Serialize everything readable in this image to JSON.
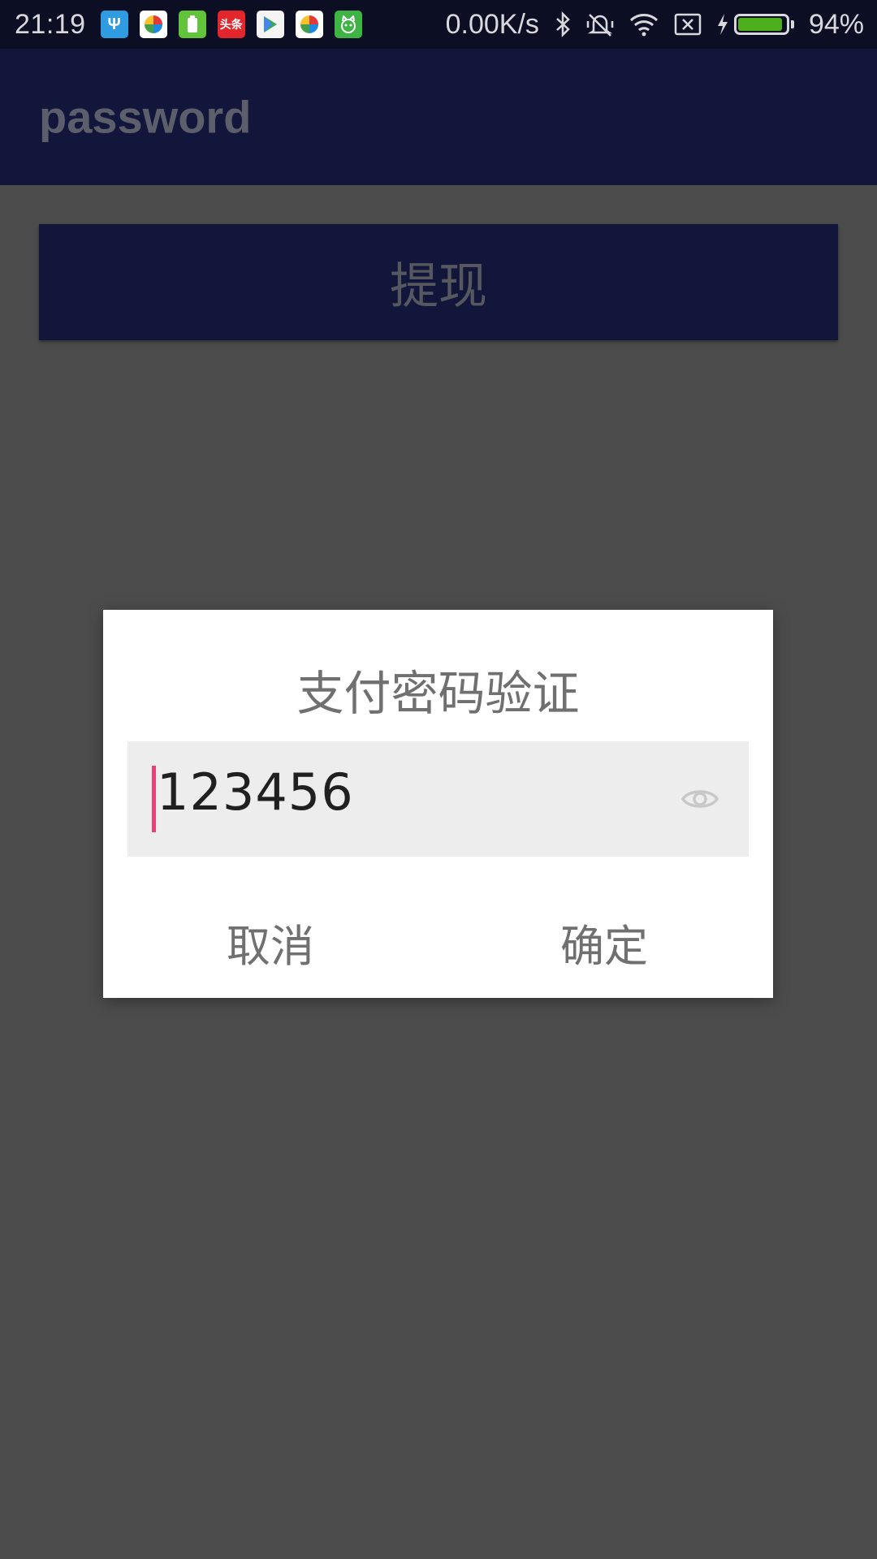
{
  "status_bar": {
    "time": "21:19",
    "network_speed": "0.00K/s",
    "battery_percent": "94%",
    "battery_level": 0.94,
    "app_icons": [
      {
        "name": "usb-icon",
        "color": "#2f9be0",
        "glyph": "Ψ"
      },
      {
        "name": "pinwheel-app-icon",
        "color": "#ffffff",
        "glyph": "◉"
      },
      {
        "name": "battery-app-icon",
        "color": "#62c43a",
        "glyph": "▮"
      },
      {
        "name": "toutiao-app-icon",
        "color": "#e3262c",
        "glyph": "头条"
      },
      {
        "name": "play-store-icon",
        "color": "#f4f4f4",
        "glyph": "▶"
      },
      {
        "name": "pinwheel-app-icon-2",
        "color": "#ffffff",
        "glyph": "◉"
      },
      {
        "name": "cat-app-icon",
        "color": "#3db444",
        "glyph": "☺"
      }
    ],
    "system_icons": [
      "bluetooth-icon",
      "mute-vibrate-icon",
      "wifi-icon",
      "no-sim-icon",
      "charging-icon"
    ]
  },
  "toolbar": {
    "title": "password"
  },
  "main": {
    "withdraw_button": "提现"
  },
  "dialog": {
    "title": "支付密码验证",
    "password_value": "123456",
    "visibility_icon": "eye-icon",
    "cancel_label": "取消",
    "confirm_label": "确定"
  },
  "colors": {
    "toolbar": "#12163a",
    "cursor": "#ec407a",
    "battery": "#4caf1b"
  }
}
